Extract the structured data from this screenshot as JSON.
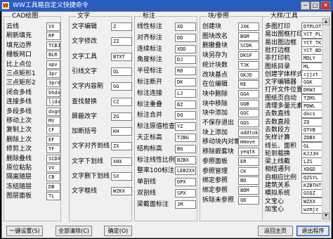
{
  "window": {
    "title": "WW工具箱自定义快捷命令",
    "logo_text": "W",
    "min_glyph": "−",
    "max_glyph": "□",
    "close_glyph": "✕"
  },
  "groups": [
    {
      "title": "CAD绘图",
      "items": [
        {
          "label": "云线",
          "cmd": "VX"
        },
        {
          "label": "刷新填充",
          "cmd": "RP"
        },
        {
          "label": "填充边界",
          "cmd": "TCBJ"
        },
        {
          "label": "栅板网口",
          "cmd": "BLR"
        },
        {
          "label": "比上点位",
          "cmd": "apv"
        },
        {
          "label": "三点矩形1",
          "cmd": "3pr"
        },
        {
          "label": "三点矩形2",
          "cmd": "3prd"
        },
        {
          "label": "闭合多线",
          "cmd": "bhdx"
        },
        {
          "label": "连接多线",
          "cmd": "ljdx"
        },
        {
          "label": "多段多线",
          "cmd": "dxgnk"
        },
        {
          "label": "移动上次",
          "cmd": "MV"
        },
        {
          "label": "复制上次",
          "cmd": "CF"
        },
        {
          "label": "删除上次",
          "cmd": "EF"
        },
        {
          "label": "修剪上次",
          "cmd": "TF"
        },
        {
          "label": "删除叠线",
          "cmd": "SCDX"
        },
        {
          "label": "原位粘贴",
          "cmd": "VV"
        },
        {
          "label": "隔离随层",
          "cmd": "CB"
        },
        {
          "label": "冻结随层",
          "cmd": "DB"
        },
        {
          "label": "图层面板",
          "cmd": "TL"
        }
      ]
    },
    {
      "title": "文字",
      "items": [
        {
          "label": "文字编辑",
          "cmd": "Z"
        },
        {
          "label": "文字修改",
          "cmd": "ZZ"
        },
        {
          "label": "文字工具",
          "cmd": "BTXT"
        },
        {
          "label": "引线文字",
          "cmd": "QL"
        },
        {
          "label": "文字内容刷",
          "cmd": "GG"
        },
        {
          "label": "查找替换",
          "cmd": "CZ"
        },
        {
          "label": "屏蔽改字",
          "cmd": "ZG"
        },
        {
          "label": "加断括号",
          "cmd": "KH"
        },
        {
          "label": "文字对齐到线",
          "cmd": "ZX"
        },
        {
          "label": "文字下划线",
          "cmd": "XHX"
        },
        {
          "label": "文字删下划线",
          "cmd": "SX"
        },
        {
          "label": "文字框线",
          "cmd": "WZKX"
        }
      ]
    },
    {
      "title": "标注",
      "items": [
        {
          "label": "线性标注",
          "cmd": "XD"
        },
        {
          "label": "对齐标注",
          "cmd": "DD"
        },
        {
          "label": "连续标注",
          "cmd": "XDD"
        },
        {
          "label": "角度标注",
          "cmd": "DJ"
        },
        {
          "label": "半径标注",
          "cmd": "RD"
        },
        {
          "label": "标注断开",
          "cmd": "DK"
        },
        {
          "label": "标注连接",
          "cmd": "LJ"
        },
        {
          "label": "标注重叠",
          "cmd": "BZ"
        },
        {
          "label": "标注合并",
          "cmd": "DQ"
        },
        {
          "label": "标注原值检查",
          "cmd": "YZ"
        },
        {
          "label": "天正标高",
          "cmd": "TZBG"
        },
        {
          "label": "结构标高",
          "cmd": "BG"
        },
        {
          "label": "标注线性比例",
          "cmd": "BZBX"
        },
        {
          "label": "整率100标注",
          "cmd": "LEBZXX"
        },
        {
          "label": "单剖线",
          "cmd": "DPX"
        },
        {
          "label": "双剖线",
          "cmd": "SPX"
        },
        {
          "label": "梁截面标注",
          "cmd": "JM"
        }
      ]
    },
    {
      "title": "块/参照",
      "items": [
        {
          "label": "创建块",
          "cmd": "JXK"
        },
        {
          "label": "图块改名",
          "cmd": "BGM"
        },
        {
          "label": "删撤叠块",
          "cmd": "SCDK"
        },
        {
          "label": "块另存为",
          "cmd": "DKSF"
        },
        {
          "label": "统计块数",
          "cmd": "TJK"
        },
        {
          "label": "改块基点",
          "cmd": "GKJD"
        },
        {
          "label": "在位编辑",
          "cmd": "RE"
        },
        {
          "label": "块中删除",
          "cmd": "GGA"
        },
        {
          "label": "块中移除",
          "cmd": "GGB"
        },
        {
          "label": "块中添加",
          "cmd": "GGC"
        },
        {
          "label": "不保存退出",
          "cmd": "GGS"
        },
        {
          "label": "块上添加",
          "cmd": "addtok"
        },
        {
          "label": "移动块内对象",
          "cmd": "mmove"
        },
        {
          "label": "移除嵌套块",
          "cmd": "yeqtk"
        },
        {
          "label": "参照面板",
          "cmd": "ER"
        },
        {
          "label": "参照管理",
          "cmd": "CK"
        },
        {
          "label": "绑定参照",
          "cmd": "BD"
        },
        {
          "label": "绑定参照",
          "cmd": "BDM"
        },
        {
          "label": "拆除未参照",
          "cmd": "QD"
        }
      ]
    },
    {
      "title": "大样/工具",
      "items": [
        {
          "label": "多图打印",
          "cmd": "DTPLOT"
        },
        {
          "label": "易出图框打印",
          "cmd": "YCT_PL"
        },
        {
          "label": "易出图边框",
          "cmd": "YCT_TK"
        },
        {
          "label": "批打边框",
          "cmd": "YCT_BD"
        },
        {
          "label": "非打印机",
          "cmd": "MDLY"
        },
        {
          "label": "图纸目录",
          "cmd": "ML"
        },
        {
          "label": "创建字体样式",
          "cmd": "cjjzt"
        },
        {
          "label": "文字编辑器",
          "cmd": "GGK"
        },
        {
          "label": "打开文件位置",
          "cmd": "DKWJ"
        },
        {
          "label": "图纸页自动",
          "cmd": "TZMS"
        },
        {
          "label": "清理多量元素",
          "cmd": "PDWL"
        },
        {
          "label": "去数直线",
          "cmd": "docs"
        },
        {
          "label": "去数直段",
          "cmd": "ZQ"
        },
        {
          "label": "去数段方",
          "cmd": "QTVB"
        },
        {
          "label": "矢样计算",
          "cmd": "ZDBX"
        },
        {
          "label": "线长、面积",
          "cmd": "GL"
        },
        {
          "label": "轮到载换",
          "cmd": "KJJJH"
        },
        {
          "label": "梁上线截",
          "cmd": "LZS"
        },
        {
          "label": "相结通列",
          "cmd": "XDGD"
        },
        {
          "label": "自相应比例",
          "cmd": "QZSYL"
        },
        {
          "label": "建筑关系",
          "cmd": "KZBTHT"
        },
        {
          "label": "模拟系统",
          "cmd": "GSQZ"
        },
        {
          "label": "文宝心",
          "cmd": "WZXX"
        },
        {
          "label": "加宝心",
          "cmd": "wzmjz"
        }
      ]
    }
  ],
  "footer": {
    "set_all": "一键设置(S)",
    "clear_all": "全部清除(C)",
    "ok": "确定(O)",
    "back": "返回主页",
    "exit": "退出程序"
  }
}
